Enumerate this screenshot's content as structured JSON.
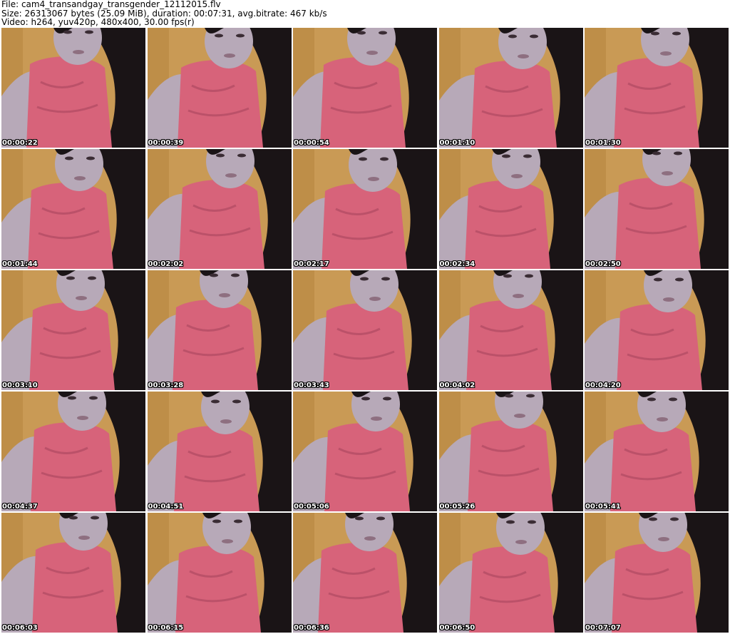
{
  "header": {
    "line1": "File: cam4_transandgay_transgender_12112015.flv",
    "line2": "Size: 26313067 bytes (25.09 MiB), duration: 00:07:31, avg.bitrate: 467 kb/s",
    "line3": "Video: h264, yuv420p, 480x400, 30.00 fps(r)"
  },
  "thumbnails": [
    {
      "timestamp": "00:00:22"
    },
    {
      "timestamp": "00:00:39"
    },
    {
      "timestamp": "00:00:54"
    },
    {
      "timestamp": "00:01:10"
    },
    {
      "timestamp": "00:01:30"
    },
    {
      "timestamp": "00:01:44"
    },
    {
      "timestamp": "00:02:02"
    },
    {
      "timestamp": "00:02:17"
    },
    {
      "timestamp": "00:02:34"
    },
    {
      "timestamp": "00:02:50"
    },
    {
      "timestamp": "00:03:10"
    },
    {
      "timestamp": "00:03:28"
    },
    {
      "timestamp": "00:03:43"
    },
    {
      "timestamp": "00:04:02"
    },
    {
      "timestamp": "00:04:20"
    },
    {
      "timestamp": "00:04:37"
    },
    {
      "timestamp": "00:04:51"
    },
    {
      "timestamp": "00:05:06"
    },
    {
      "timestamp": "00:05:26"
    },
    {
      "timestamp": "00:05:41"
    },
    {
      "timestamp": "00:06:03"
    },
    {
      "timestamp": "00:06:15"
    },
    {
      "timestamp": "00:06:36"
    },
    {
      "timestamp": "00:06:50"
    },
    {
      "timestamp": "00:07:07"
    }
  ],
  "colors": {
    "background_wall": "#c99a55",
    "skin": "#b7a9b8",
    "dress": "#d7637a",
    "hair": "#1a1416",
    "timestamp_text": "#ffffff",
    "timestamp_outline": "#000000"
  }
}
